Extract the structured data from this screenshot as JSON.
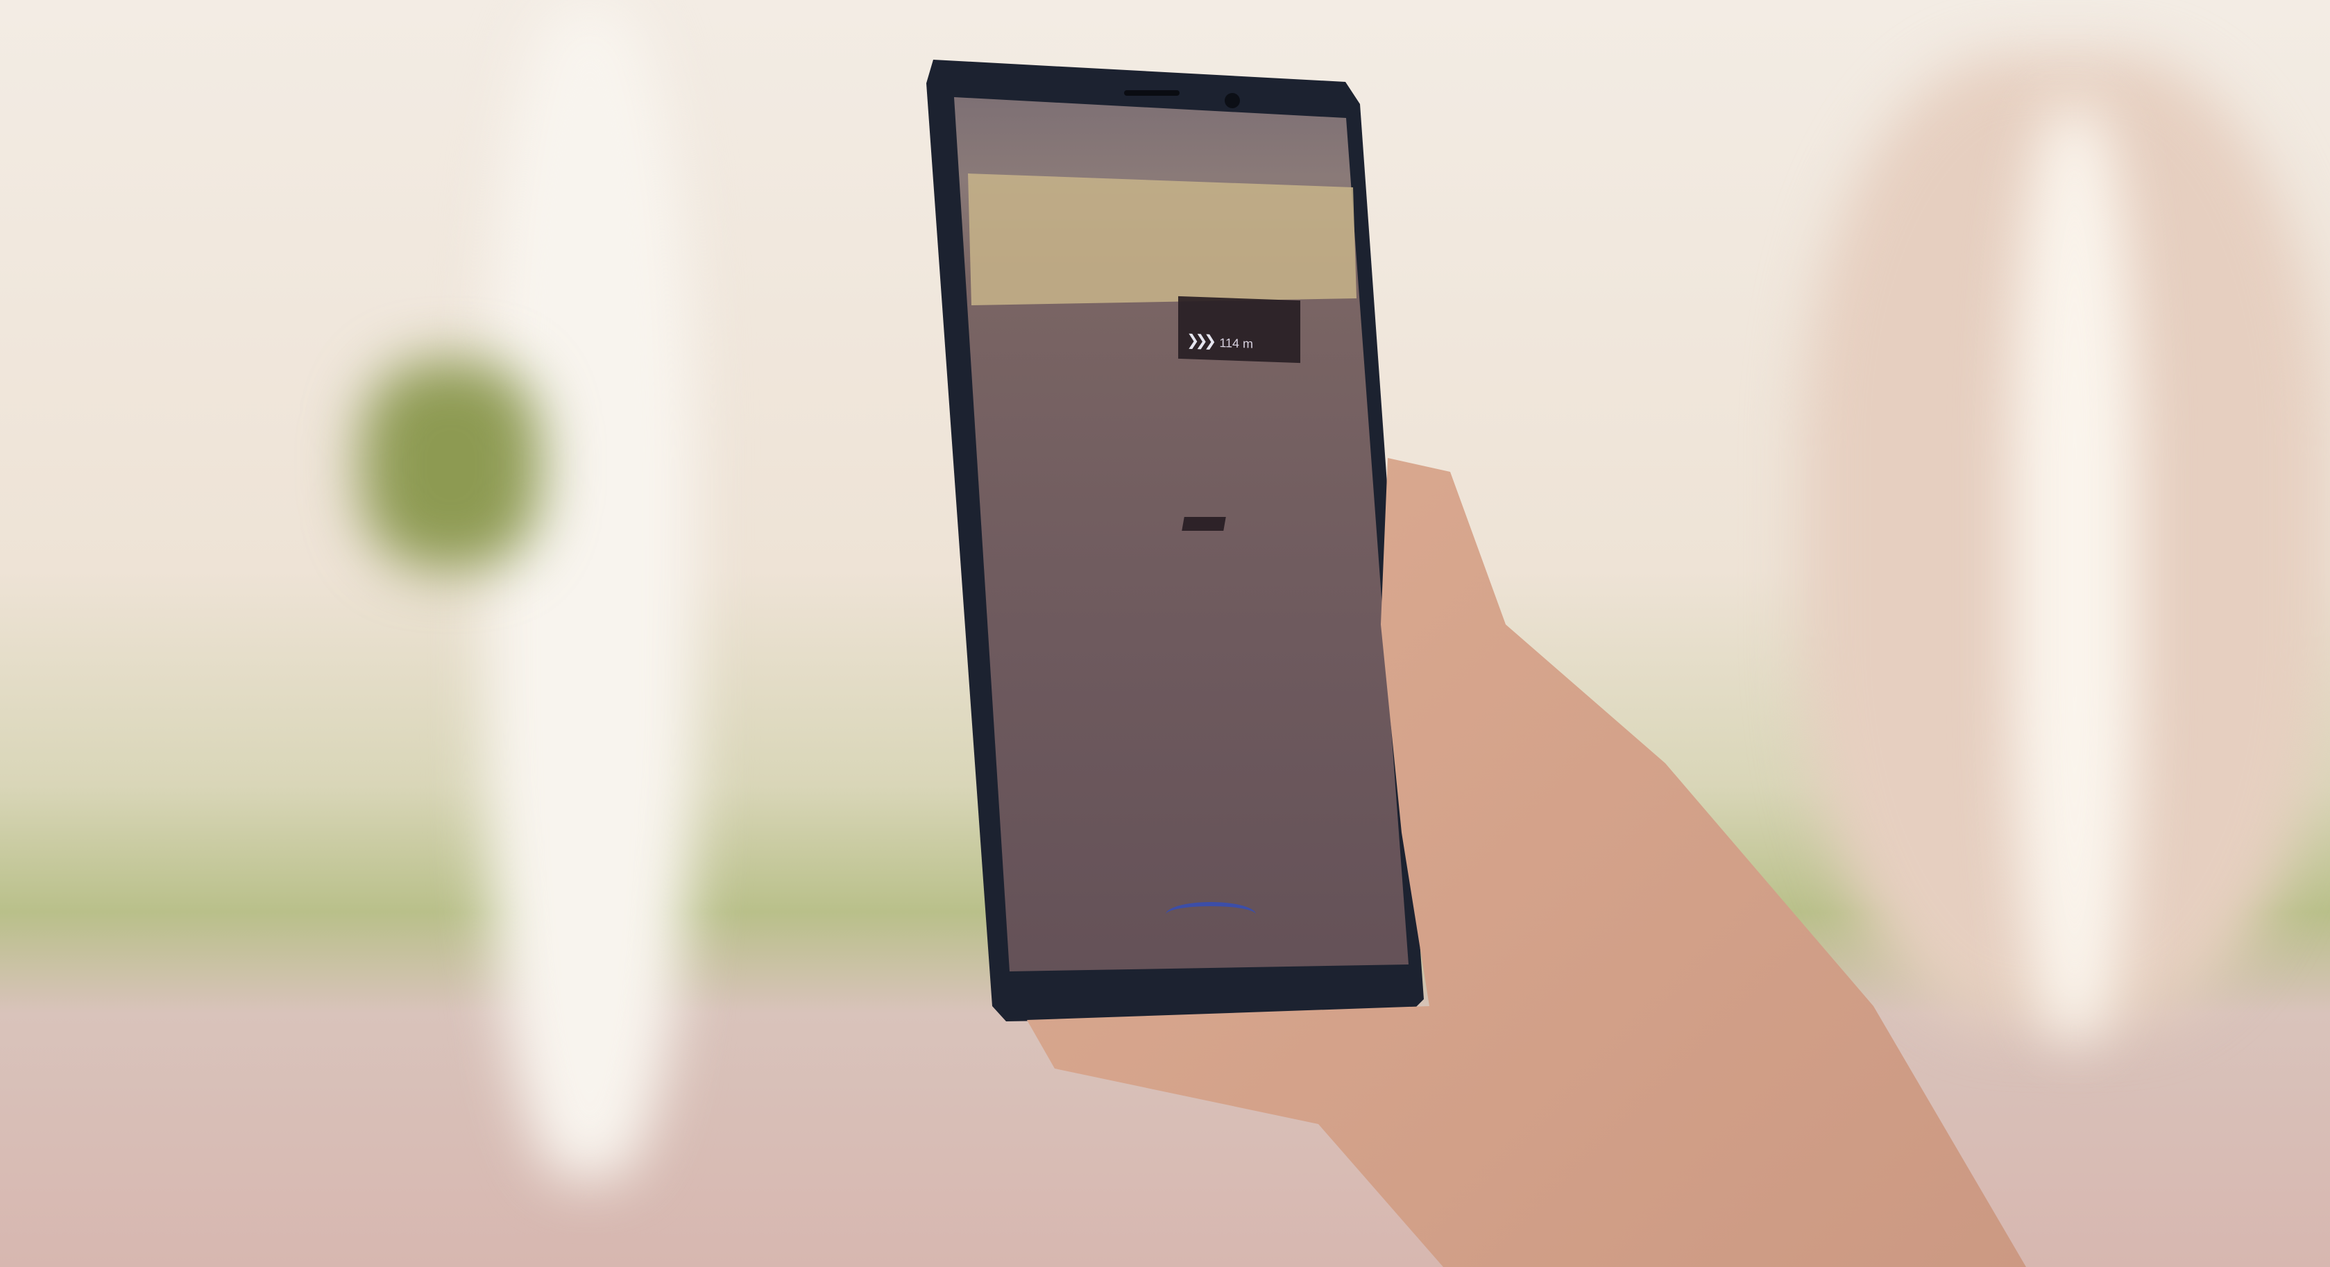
{
  "scene": "phone-ar-navigation",
  "ar": {
    "distance": "114 m",
    "icon": "chevrons-right-icon",
    "arc_color": "#3c4ea8"
  },
  "colors": {
    "phone": "#1c2230",
    "background": "#eee3d6",
    "grass": "#b9c08a"
  }
}
